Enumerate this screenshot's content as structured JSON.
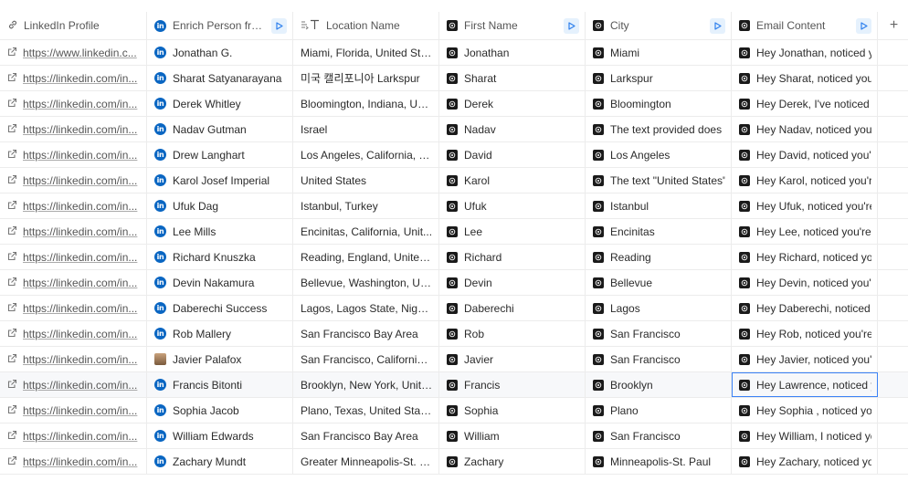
{
  "columns": [
    {
      "label": "LinkedIn Profile",
      "icon": "link-icon"
    },
    {
      "label": "Enrich Person from...",
      "icon": "linkedin-icon"
    },
    {
      "label": "Location Name",
      "icon": "text-formula-icon"
    },
    {
      "label": "First Name",
      "icon": "ai-icon"
    },
    {
      "label": "City",
      "icon": "ai-icon"
    },
    {
      "label": "Email Content",
      "icon": "ai-icon"
    }
  ],
  "add_column_label": "+",
  "rows": [
    {
      "url": "https://www.linkedin.c...",
      "person": "Jonathan G.",
      "location": "Miami, Florida, United Sta...",
      "first": "Jonathan",
      "city": "Miami",
      "email": "Hey Jonathan, noticed y"
    },
    {
      "url": "https://linkedin.com/in...",
      "person": "Sharat Satyanarayana",
      "location": "미국 캘리포니아 Larkspur",
      "first": "Sharat",
      "city": "Larkspur",
      "email": "Hey Sharat, noticed you"
    },
    {
      "url": "https://linkedin.com/in...",
      "person": "Derek Whitley",
      "location": "Bloomington, Indiana, Uni...",
      "first": "Derek",
      "city": "Bloomington",
      "email": "Hey Derek, I've noticed y"
    },
    {
      "url": "https://linkedin.com/in...",
      "person": "Nadav Gutman",
      "location": "Israel",
      "first": "Nadav",
      "city": "The text provided does",
      "email": "Hey Nadav, noticed you"
    },
    {
      "url": "https://linkedin.com/in...",
      "person": "Drew Langhart",
      "location": "Los Angeles, California, U...",
      "first": "David",
      "city": "Los Angeles",
      "email": "Hey David, noticed you'r"
    },
    {
      "url": "https://linkedin.com/in...",
      "person": "Karol Josef Imperial",
      "location": "United States",
      "first": "Karol",
      "city": "The text \"United States\"",
      "email": "Hey Karol, noticed you'r"
    },
    {
      "url": "https://linkedin.com/in...",
      "person": "Ufuk Dag",
      "location": "Istanbul, Turkey",
      "first": "Ufuk",
      "city": "Istanbul",
      "email": "Hey Ufuk, noticed you're"
    },
    {
      "url": "https://linkedin.com/in...",
      "person": "Lee Mills",
      "location": "Encinitas, California, Unit...",
      "first": "Lee",
      "city": "Encinitas",
      "email": "Hey Lee, noticed you're"
    },
    {
      "url": "https://linkedin.com/in...",
      "person": "Richard Knuszka",
      "location": "Reading, England, United ...",
      "first": "Richard",
      "city": "Reading",
      "email": "Hey Richard, noticed yo"
    },
    {
      "url": "https://linkedin.com/in...",
      "person": "Devin Nakamura",
      "location": "Bellevue, Washington, Uni...",
      "first": "Devin",
      "city": "Bellevue",
      "email": "Hey Devin, noticed you'r"
    },
    {
      "url": "https://linkedin.com/in...",
      "person": "Daberechi Success",
      "location": "Lagos, Lagos State, Nigeria",
      "first": "Daberechi",
      "city": "Lagos",
      "email": "Hey Daberechi, noticed"
    },
    {
      "url": "https://linkedin.com/in...",
      "person": "Rob Mallery",
      "location": "San Francisco Bay Area",
      "first": "Rob",
      "city": "San Francisco",
      "email": "Hey Rob, noticed you're"
    },
    {
      "url": "https://linkedin.com/in...",
      "person": "Javier Palafox",
      "location": "San Francisco, California, ...",
      "first": "Javier",
      "city": "San Francisco",
      "email": "Hey Javier, noticed you'",
      "avatar": true
    },
    {
      "url": "https://linkedin.com/in...",
      "person": "Francis Bitonti",
      "location": "Brooklyn, New York, Unite...",
      "first": "Francis",
      "city": "Brooklyn",
      "email": "Hey Lawrence, noticed y",
      "selected": true
    },
    {
      "url": "https://linkedin.com/in...",
      "person": "Sophia Jacob",
      "location": "Plano, Texas, United States",
      "first": "Sophia",
      "city": "Plano",
      "email": "Hey Sophia , noticed you"
    },
    {
      "url": "https://linkedin.com/in...",
      "person": "William Edwards",
      "location": "San Francisco Bay Area",
      "first": "William",
      "city": "San Francisco",
      "email": "Hey William, I noticed yo"
    },
    {
      "url": "https://linkedin.com/in...",
      "person": "Zachary Mundt",
      "location": "Greater Minneapolis-St. P...",
      "first": "Zachary",
      "city": "Minneapolis-St. Paul",
      "email": "Hey Zachary, noticed yo"
    }
  ]
}
